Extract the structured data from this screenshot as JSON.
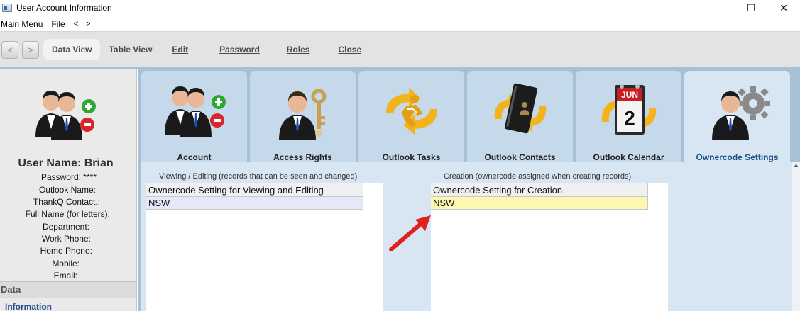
{
  "window": {
    "title": "User Account Information",
    "controls": [
      "—",
      "☐",
      "✕"
    ]
  },
  "menubar": {
    "items": [
      "Main Menu",
      "File"
    ],
    "back_arrow": "<",
    "forward_arrow": ">"
  },
  "toolbar": {
    "back": "<",
    "forward": ">",
    "buttons": [
      "Data View",
      "Table View",
      "Edit",
      "Password",
      "Roles",
      "Close"
    ]
  },
  "left_panel": {
    "user_name": "User Name: Brian",
    "fields": [
      "Password: ****",
      "Outlook Name:",
      "ThankQ Contact.:",
      "Full Name (for letters):",
      "Department:",
      "Work Phone:",
      "Home Phone:",
      "Mobile:",
      "Email:"
    ],
    "section_header": "Data",
    "section_item": "Information"
  },
  "tabs": [
    {
      "label": "Account",
      "icon": "users-add-remove-icon"
    },
    {
      "label": "Access Rights",
      "icon": "user-key-icon"
    },
    {
      "label": "Outlook Tasks",
      "icon": "tasks-sync-icon"
    },
    {
      "label": "Outlook Contacts",
      "icon": "contacts-sync-icon"
    },
    {
      "label": "Outlook Calendar",
      "icon": "calendar-sync-icon"
    },
    {
      "label": "Ownercode Settings",
      "icon": "user-gear-icon",
      "active": true
    }
  ],
  "calendar_icon": {
    "month": "JUN",
    "day": "2"
  },
  "viewing": {
    "group_title": "Viewing / Editing (records that can be seen and changed)",
    "column_header": "Ownercode Setting for Viewing and Editing",
    "rows": [
      "NSW"
    ]
  },
  "creation": {
    "group_title": "Creation (ownercode assigned when creating records)",
    "column_header": "Ownercode Setting for Creation",
    "rows": [
      "NSW"
    ]
  },
  "colors": {
    "accent_blue": "#a6c0d8",
    "tab_bg": "#c5d9eb",
    "active_tab_text": "#1f4f8a",
    "highlight_yellow": "#fdf7b0",
    "annotation_red": "#e0201e"
  }
}
